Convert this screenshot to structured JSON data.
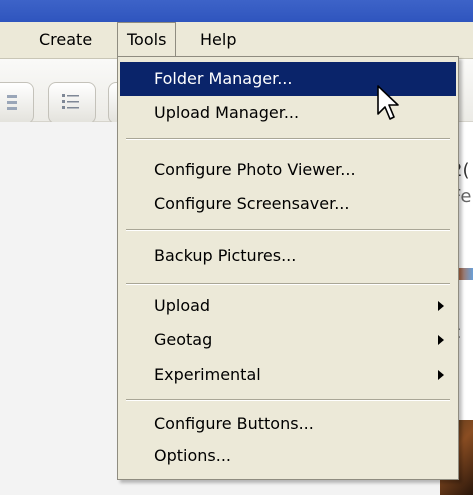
{
  "menubar": {
    "create": "Create",
    "tools": "Tools",
    "help": "Help"
  },
  "tools_menu": {
    "folder_manager": "Folder Manager...",
    "upload_manager": "Upload Manager...",
    "configure_photo_viewer": "Configure Photo Viewer...",
    "configure_screensaver": "Configure Screensaver...",
    "backup_pictures": "Backup Pictures...",
    "upload": "Upload",
    "geotag": "Geotag",
    "experimental": "Experimental",
    "configure_buttons": "Configure Buttons...",
    "options": "Options..."
  },
  "right_pane": {
    "line1": "2(",
    "line2": "Fe",
    "line3": "c"
  },
  "colors": {
    "menu_bg": "#ece9d8",
    "highlight": "#0a246a",
    "titlebar": "#2f55be"
  },
  "icons": [
    "grid-view-icon",
    "list-view-icon",
    "mouse-pointer-icon",
    "submenu-arrow-icon"
  ]
}
